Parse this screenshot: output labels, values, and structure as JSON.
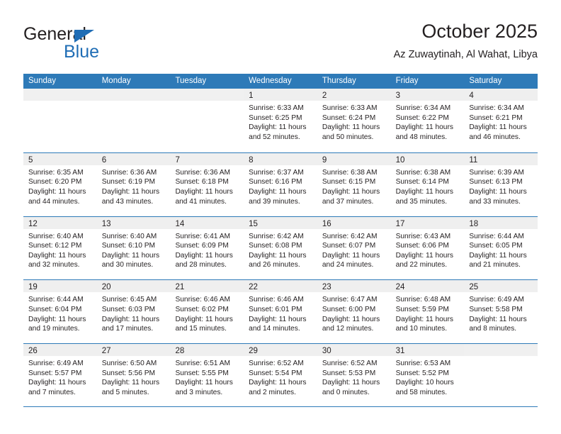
{
  "brand": {
    "name_top": "General",
    "name_bottom": "Blue",
    "triangle_color": "#1f6db5"
  },
  "header": {
    "title": "October 2025",
    "subtitle": "Az Zuwaytinah, Al Wahat, Libya"
  },
  "theme": {
    "header_blue": "#2e7ab8",
    "daynum_band": "#efefef",
    "text": "#231f20"
  },
  "weekdays": [
    "Sunday",
    "Monday",
    "Tuesday",
    "Wednesday",
    "Thursday",
    "Friday",
    "Saturday"
  ],
  "weeks": [
    [
      {
        "day": "",
        "sunrise": "",
        "sunset": "",
        "daylight": "",
        "empty": true
      },
      {
        "day": "",
        "sunrise": "",
        "sunset": "",
        "daylight": "",
        "empty": true
      },
      {
        "day": "",
        "sunrise": "",
        "sunset": "",
        "daylight": "",
        "empty": true
      },
      {
        "day": "1",
        "sunrise": "Sunrise: 6:33 AM",
        "sunset": "Sunset: 6:25 PM",
        "daylight": "Daylight: 11 hours and 52 minutes."
      },
      {
        "day": "2",
        "sunrise": "Sunrise: 6:33 AM",
        "sunset": "Sunset: 6:24 PM",
        "daylight": "Daylight: 11 hours and 50 minutes."
      },
      {
        "day": "3",
        "sunrise": "Sunrise: 6:34 AM",
        "sunset": "Sunset: 6:22 PM",
        "daylight": "Daylight: 11 hours and 48 minutes."
      },
      {
        "day": "4",
        "sunrise": "Sunrise: 6:34 AM",
        "sunset": "Sunset: 6:21 PM",
        "daylight": "Daylight: 11 hours and 46 minutes."
      }
    ],
    [
      {
        "day": "5",
        "sunrise": "Sunrise: 6:35 AM",
        "sunset": "Sunset: 6:20 PM",
        "daylight": "Daylight: 11 hours and 44 minutes."
      },
      {
        "day": "6",
        "sunrise": "Sunrise: 6:36 AM",
        "sunset": "Sunset: 6:19 PM",
        "daylight": "Daylight: 11 hours and 43 minutes."
      },
      {
        "day": "7",
        "sunrise": "Sunrise: 6:36 AM",
        "sunset": "Sunset: 6:18 PM",
        "daylight": "Daylight: 11 hours and 41 minutes."
      },
      {
        "day": "8",
        "sunrise": "Sunrise: 6:37 AM",
        "sunset": "Sunset: 6:16 PM",
        "daylight": "Daylight: 11 hours and 39 minutes."
      },
      {
        "day": "9",
        "sunrise": "Sunrise: 6:38 AM",
        "sunset": "Sunset: 6:15 PM",
        "daylight": "Daylight: 11 hours and 37 minutes."
      },
      {
        "day": "10",
        "sunrise": "Sunrise: 6:38 AM",
        "sunset": "Sunset: 6:14 PM",
        "daylight": "Daylight: 11 hours and 35 minutes."
      },
      {
        "day": "11",
        "sunrise": "Sunrise: 6:39 AM",
        "sunset": "Sunset: 6:13 PM",
        "daylight": "Daylight: 11 hours and 33 minutes."
      }
    ],
    [
      {
        "day": "12",
        "sunrise": "Sunrise: 6:40 AM",
        "sunset": "Sunset: 6:12 PM",
        "daylight": "Daylight: 11 hours and 32 minutes."
      },
      {
        "day": "13",
        "sunrise": "Sunrise: 6:40 AM",
        "sunset": "Sunset: 6:10 PM",
        "daylight": "Daylight: 11 hours and 30 minutes."
      },
      {
        "day": "14",
        "sunrise": "Sunrise: 6:41 AM",
        "sunset": "Sunset: 6:09 PM",
        "daylight": "Daylight: 11 hours and 28 minutes."
      },
      {
        "day": "15",
        "sunrise": "Sunrise: 6:42 AM",
        "sunset": "Sunset: 6:08 PM",
        "daylight": "Daylight: 11 hours and 26 minutes."
      },
      {
        "day": "16",
        "sunrise": "Sunrise: 6:42 AM",
        "sunset": "Sunset: 6:07 PM",
        "daylight": "Daylight: 11 hours and 24 minutes."
      },
      {
        "day": "17",
        "sunrise": "Sunrise: 6:43 AM",
        "sunset": "Sunset: 6:06 PM",
        "daylight": "Daylight: 11 hours and 22 minutes."
      },
      {
        "day": "18",
        "sunrise": "Sunrise: 6:44 AM",
        "sunset": "Sunset: 6:05 PM",
        "daylight": "Daylight: 11 hours and 21 minutes."
      }
    ],
    [
      {
        "day": "19",
        "sunrise": "Sunrise: 6:44 AM",
        "sunset": "Sunset: 6:04 PM",
        "daylight": "Daylight: 11 hours and 19 minutes."
      },
      {
        "day": "20",
        "sunrise": "Sunrise: 6:45 AM",
        "sunset": "Sunset: 6:03 PM",
        "daylight": "Daylight: 11 hours and 17 minutes."
      },
      {
        "day": "21",
        "sunrise": "Sunrise: 6:46 AM",
        "sunset": "Sunset: 6:02 PM",
        "daylight": "Daylight: 11 hours and 15 minutes."
      },
      {
        "day": "22",
        "sunrise": "Sunrise: 6:46 AM",
        "sunset": "Sunset: 6:01 PM",
        "daylight": "Daylight: 11 hours and 14 minutes."
      },
      {
        "day": "23",
        "sunrise": "Sunrise: 6:47 AM",
        "sunset": "Sunset: 6:00 PM",
        "daylight": "Daylight: 11 hours and 12 minutes."
      },
      {
        "day": "24",
        "sunrise": "Sunrise: 6:48 AM",
        "sunset": "Sunset: 5:59 PM",
        "daylight": "Daylight: 11 hours and 10 minutes."
      },
      {
        "day": "25",
        "sunrise": "Sunrise: 6:49 AM",
        "sunset": "Sunset: 5:58 PM",
        "daylight": "Daylight: 11 hours and 8 minutes."
      }
    ],
    [
      {
        "day": "26",
        "sunrise": "Sunrise: 6:49 AM",
        "sunset": "Sunset: 5:57 PM",
        "daylight": "Daylight: 11 hours and 7 minutes."
      },
      {
        "day": "27",
        "sunrise": "Sunrise: 6:50 AM",
        "sunset": "Sunset: 5:56 PM",
        "daylight": "Daylight: 11 hours and 5 minutes."
      },
      {
        "day": "28",
        "sunrise": "Sunrise: 6:51 AM",
        "sunset": "Sunset: 5:55 PM",
        "daylight": "Daylight: 11 hours and 3 minutes."
      },
      {
        "day": "29",
        "sunrise": "Sunrise: 6:52 AM",
        "sunset": "Sunset: 5:54 PM",
        "daylight": "Daylight: 11 hours and 2 minutes."
      },
      {
        "day": "30",
        "sunrise": "Sunrise: 6:52 AM",
        "sunset": "Sunset: 5:53 PM",
        "daylight": "Daylight: 11 hours and 0 minutes."
      },
      {
        "day": "31",
        "sunrise": "Sunrise: 6:53 AM",
        "sunset": "Sunset: 5:52 PM",
        "daylight": "Daylight: 10 hours and 58 minutes."
      },
      {
        "day": "",
        "sunrise": "",
        "sunset": "",
        "daylight": "",
        "empty": true
      }
    ]
  ]
}
